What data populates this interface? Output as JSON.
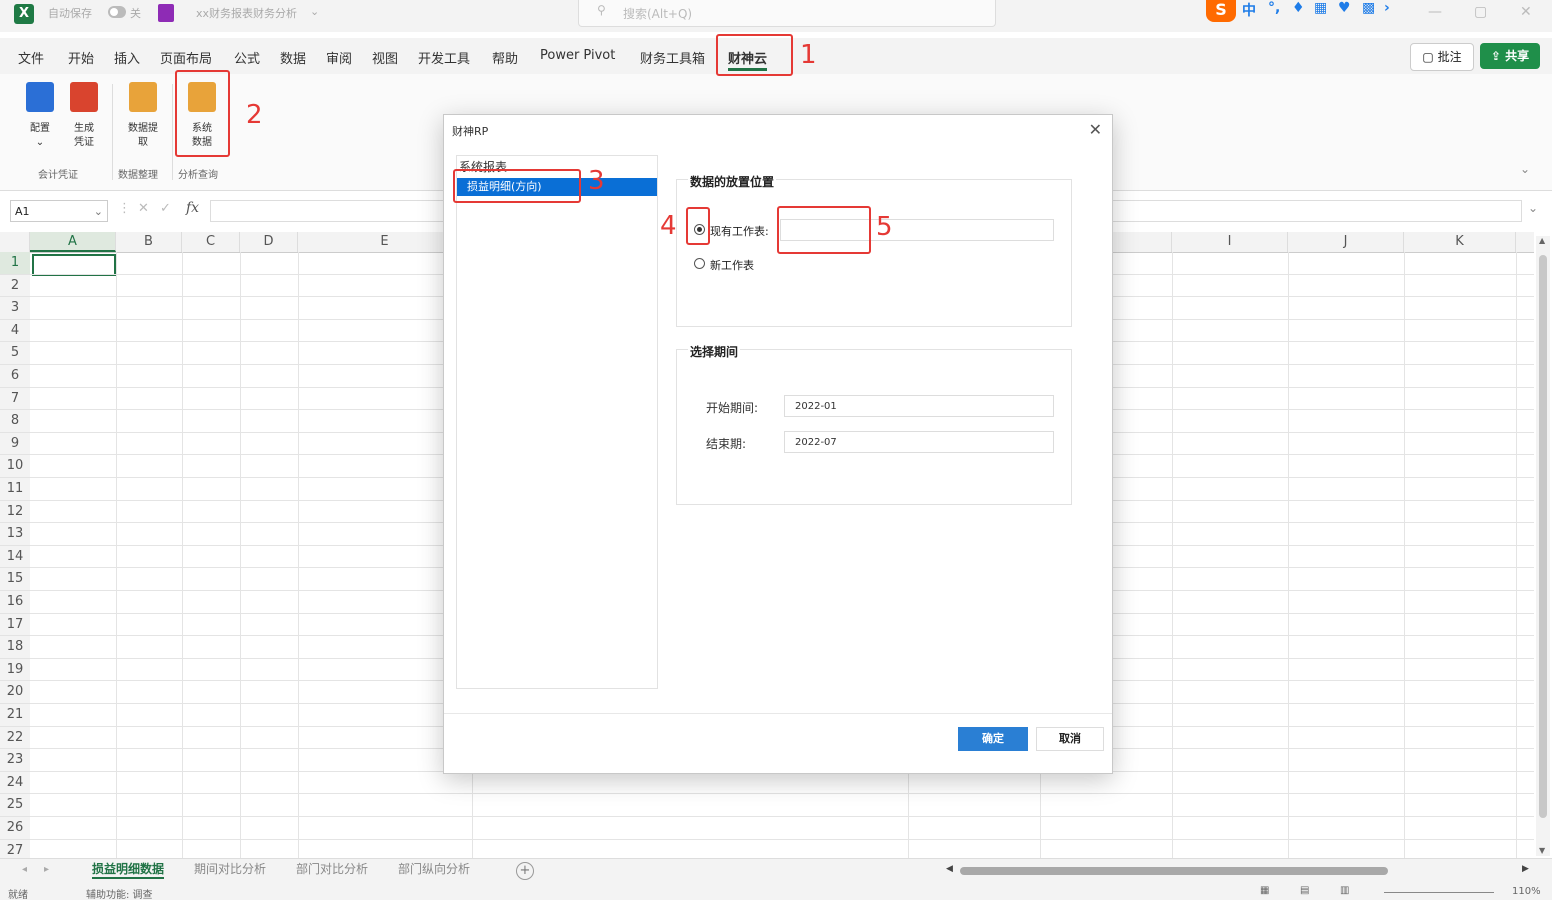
{
  "titlebar": {
    "autosave": "自动保存",
    "toggle_state": "关",
    "filename": "xx财务报表财务分析",
    "search_placeholder": "搜索(Alt+Q)"
  },
  "menu": [
    "文件",
    "开始",
    "插入",
    "页面布局",
    "公式",
    "数据",
    "审阅",
    "视图",
    "开发工具",
    "帮助",
    "Power Pivot",
    "财务工具箱",
    "财神云"
  ],
  "menu_active_index": 12,
  "comment_label": "批注",
  "share_label": "共享",
  "ribbon": {
    "buttons": [
      {
        "label1": "配置",
        "label2": "",
        "color": "#2b6fd6"
      },
      {
        "label1": "生成",
        "label2": "凭证",
        "color": "#d9442e"
      },
      {
        "label1": "数据提",
        "label2": "取",
        "color": "#e8a33a"
      },
      {
        "label1": "系统",
        "label2": "数据",
        "color": "#e8a33a"
      }
    ],
    "groups": [
      "会计凭证",
      "数据整理",
      "分析查询"
    ]
  },
  "formula_bar": {
    "name_box": "A1"
  },
  "columns": [
    "A",
    "B",
    "C",
    "D",
    "E",
    "I",
    "J",
    "K"
  ],
  "rows": [
    "1",
    "2",
    "3",
    "4",
    "5",
    "6",
    "7",
    "8",
    "9",
    "10",
    "11",
    "12",
    "13",
    "14",
    "15",
    "16",
    "17",
    "18",
    "19",
    "20",
    "21",
    "22",
    "23",
    "24",
    "25",
    "26",
    "27"
  ],
  "sheet_tabs": [
    "损益明细数据",
    "期间对比分析",
    "部门对比分析",
    "部门纵向分析"
  ],
  "status": {
    "left": "就绪",
    "accessibility": "辅助功能: 调查",
    "zoom": "110%"
  },
  "dialog": {
    "title": "财神RP",
    "list_header": "系统报表",
    "list_selected": "损益明细(方向)",
    "section_place": "数据的放置位置",
    "radio_existing": "现有工作表:",
    "radio_new": "新工作表",
    "section_period": "选择期间",
    "start_label": "开始期间:",
    "start_value": "2022-01",
    "end_label": "结束期:",
    "end_value": "2022-07",
    "ok": "确定",
    "cancel": "取消"
  },
  "annotations": [
    "1",
    "2",
    "3",
    "4",
    "5"
  ],
  "colors": {
    "excel_green": "#217346",
    "annotation_red": "#e53935",
    "selection_blue": "#0a6fd6"
  }
}
